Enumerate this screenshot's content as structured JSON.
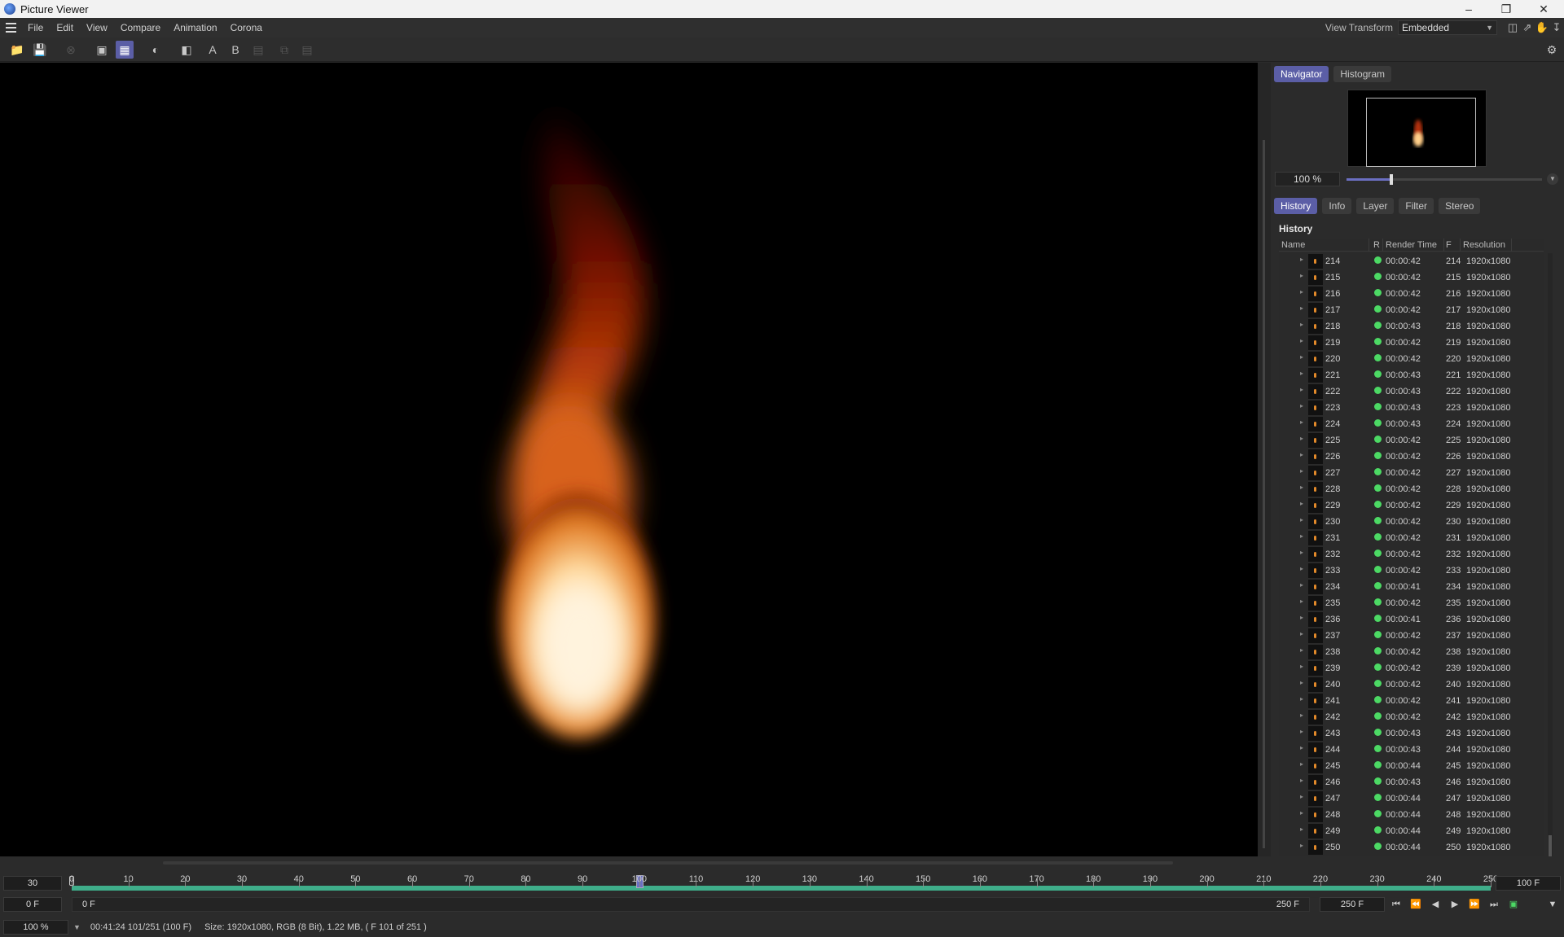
{
  "window": {
    "title": "Picture Viewer"
  },
  "menu": [
    "File",
    "Edit",
    "View",
    "Compare",
    "Animation",
    "Corona"
  ],
  "view_transform": {
    "label": "View Transform",
    "value": "Embedded"
  },
  "toolbar": {
    "label_a": "A",
    "label_b": "B"
  },
  "navigator": {
    "tabs": [
      "Navigator",
      "Histogram"
    ],
    "zoom": "100 %",
    "zoom_slider_fraction": 0.23
  },
  "history_tabs": [
    "History",
    "Info",
    "Layer",
    "Filter",
    "Stereo"
  ],
  "history": {
    "title": "History",
    "columns": [
      "Name",
      "R",
      "Render Time",
      "F",
      "Resolution"
    ],
    "rows": [
      {
        "name": "214",
        "time": "00:00:42",
        "f": "214",
        "res": "1920x1080"
      },
      {
        "name": "215",
        "time": "00:00:42",
        "f": "215",
        "res": "1920x1080"
      },
      {
        "name": "216",
        "time": "00:00:42",
        "f": "216",
        "res": "1920x1080"
      },
      {
        "name": "217",
        "time": "00:00:42",
        "f": "217",
        "res": "1920x1080"
      },
      {
        "name": "218",
        "time": "00:00:43",
        "f": "218",
        "res": "1920x1080"
      },
      {
        "name": "219",
        "time": "00:00:42",
        "f": "219",
        "res": "1920x1080"
      },
      {
        "name": "220",
        "time": "00:00:42",
        "f": "220",
        "res": "1920x1080"
      },
      {
        "name": "221",
        "time": "00:00:43",
        "f": "221",
        "res": "1920x1080"
      },
      {
        "name": "222",
        "time": "00:00:43",
        "f": "222",
        "res": "1920x1080"
      },
      {
        "name": "223",
        "time": "00:00:43",
        "f": "223",
        "res": "1920x1080"
      },
      {
        "name": "224",
        "time": "00:00:43",
        "f": "224",
        "res": "1920x1080"
      },
      {
        "name": "225",
        "time": "00:00:42",
        "f": "225",
        "res": "1920x1080"
      },
      {
        "name": "226",
        "time": "00:00:42",
        "f": "226",
        "res": "1920x1080"
      },
      {
        "name": "227",
        "time": "00:00:42",
        "f": "227",
        "res": "1920x1080"
      },
      {
        "name": "228",
        "time": "00:00:42",
        "f": "228",
        "res": "1920x1080"
      },
      {
        "name": "229",
        "time": "00:00:42",
        "f": "229",
        "res": "1920x1080"
      },
      {
        "name": "230",
        "time": "00:00:42",
        "f": "230",
        "res": "1920x1080"
      },
      {
        "name": "231",
        "time": "00:00:42",
        "f": "231",
        "res": "1920x1080"
      },
      {
        "name": "232",
        "time": "00:00:42",
        "f": "232",
        "res": "1920x1080"
      },
      {
        "name": "233",
        "time": "00:00:42",
        "f": "233",
        "res": "1920x1080"
      },
      {
        "name": "234",
        "time": "00:00:41",
        "f": "234",
        "res": "1920x1080"
      },
      {
        "name": "235",
        "time": "00:00:42",
        "f": "235",
        "res": "1920x1080"
      },
      {
        "name": "236",
        "time": "00:00:41",
        "f": "236",
        "res": "1920x1080"
      },
      {
        "name": "237",
        "time": "00:00:42",
        "f": "237",
        "res": "1920x1080"
      },
      {
        "name": "238",
        "time": "00:00:42",
        "f": "238",
        "res": "1920x1080"
      },
      {
        "name": "239",
        "time": "00:00:42",
        "f": "239",
        "res": "1920x1080"
      },
      {
        "name": "240",
        "time": "00:00:42",
        "f": "240",
        "res": "1920x1080"
      },
      {
        "name": "241",
        "time": "00:00:42",
        "f": "241",
        "res": "1920x1080"
      },
      {
        "name": "242",
        "time": "00:00:42",
        "f": "242",
        "res": "1920x1080"
      },
      {
        "name": "243",
        "time": "00:00:43",
        "f": "243",
        "res": "1920x1080"
      },
      {
        "name": "244",
        "time": "00:00:43",
        "f": "244",
        "res": "1920x1080"
      },
      {
        "name": "245",
        "time": "00:00:44",
        "f": "245",
        "res": "1920x1080"
      },
      {
        "name": "246",
        "time": "00:00:43",
        "f": "246",
        "res": "1920x1080"
      },
      {
        "name": "247",
        "time": "00:00:44",
        "f": "247",
        "res": "1920x1080"
      },
      {
        "name": "248",
        "time": "00:00:44",
        "f": "248",
        "res": "1920x1080"
      },
      {
        "name": "249",
        "time": "00:00:44",
        "f": "249",
        "res": "1920x1080"
      },
      {
        "name": "250",
        "time": "00:00:44",
        "f": "250",
        "res": "1920x1080"
      }
    ]
  },
  "timeline": {
    "fps": "30",
    "current_frame": "100",
    "frame_end_box": "100 F",
    "ticks": [
      "0",
      "10",
      "20",
      "30",
      "40",
      "50",
      "60",
      "70",
      "80",
      "90",
      "100",
      "110",
      "120",
      "130",
      "140",
      "150",
      "160",
      "170",
      "180",
      "190",
      "200",
      "210",
      "220",
      "230",
      "240",
      "250"
    ],
    "range_start": "0 F",
    "range_start_inner": "0 F",
    "range_end_inner": "250 F",
    "range_end": "250 F",
    "max_frame": 250
  },
  "status": {
    "zoom": "100 %",
    "info": "00:41:24 101/251 (100 F)",
    "size": "Size: 1920x1080, RGB (8 Bit), 1.22 MB,  ( F 101 of 251 )"
  },
  "colors": {
    "accent": "#5b5ea6",
    "status_ok": "#4cd964",
    "timeline": "#3fae8a"
  }
}
